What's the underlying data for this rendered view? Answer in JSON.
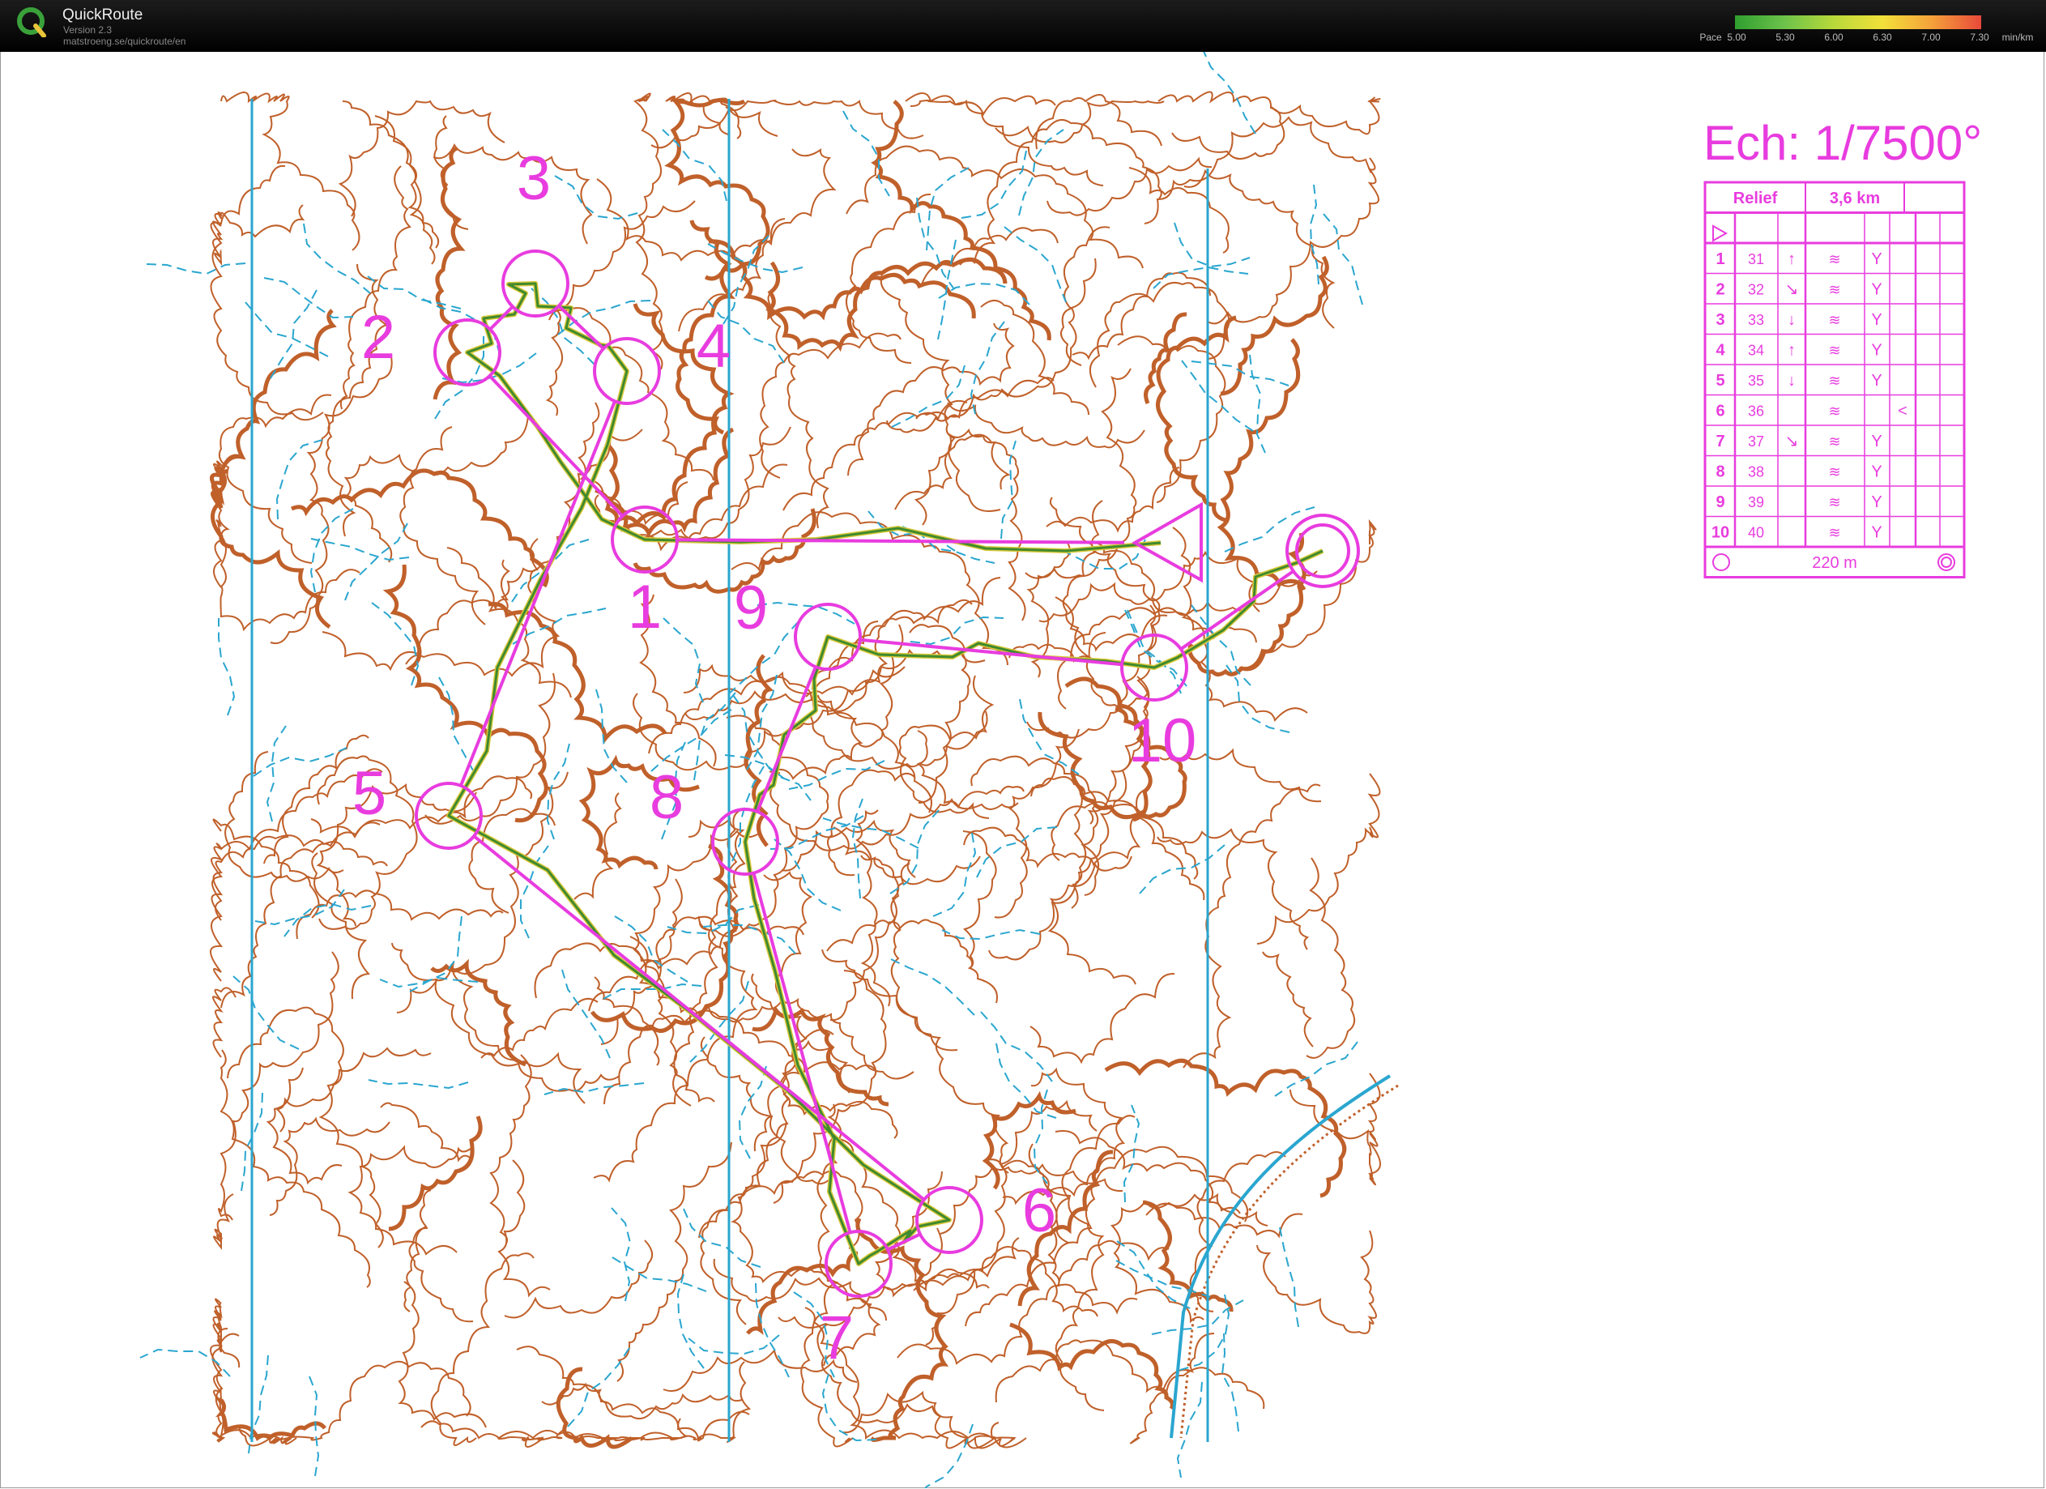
{
  "app": {
    "title": "QuickRoute",
    "version": "Version 2.3",
    "url": "matstroeng.se/quickroute/en"
  },
  "pace_legend": {
    "label": "Pace",
    "ticks": [
      "5.00",
      "5.30",
      "6.00",
      "6.30",
      "7.00",
      "7.30"
    ],
    "unit": "min/km",
    "colors": [
      "#2f9e2f",
      "#6cc24a",
      "#b8d93a",
      "#f2e03a",
      "#f5a13a",
      "#e84a3a"
    ]
  },
  "map": {
    "scale_text": "Ech: 1/7500°",
    "contour_color": "#c0602a",
    "water_color": "#2aa6cf",
    "course_color": "#e83cdf",
    "route_colors": [
      "#3f8a2f",
      "#d9c83a"
    ]
  },
  "course": {
    "controls": [
      {
        "number": "1"
      },
      {
        "number": "2"
      },
      {
        "number": "3"
      },
      {
        "number": "4"
      },
      {
        "number": "5"
      },
      {
        "number": "6"
      },
      {
        "number": "7"
      },
      {
        "number": "8"
      },
      {
        "number": "9"
      },
      {
        "number": "10"
      }
    ]
  },
  "description_sheet": {
    "title": "Relief",
    "length": "3,6 km",
    "rows": [
      {
        "num": "1",
        "code": "31",
        "dir": "↑",
        "feat": "≋",
        "detail": "Y",
        "extra": ""
      },
      {
        "num": "2",
        "code": "32",
        "dir": "↘",
        "feat": "≋",
        "detail": "Y",
        "extra": ""
      },
      {
        "num": "3",
        "code": "33",
        "dir": "↓",
        "feat": "≋",
        "detail": "Y",
        "extra": ""
      },
      {
        "num": "4",
        "code": "34",
        "dir": "↑",
        "feat": "≋",
        "detail": "Y",
        "extra": ""
      },
      {
        "num": "5",
        "code": "35",
        "dir": "↓",
        "feat": "≋",
        "detail": "Y",
        "extra": ""
      },
      {
        "num": "6",
        "code": "36",
        "dir": "",
        "feat": "≋",
        "detail": "",
        "extra": "<"
      },
      {
        "num": "7",
        "code": "37",
        "dir": "↘",
        "feat": "≋",
        "detail": "Y",
        "extra": ""
      },
      {
        "num": "8",
        "code": "38",
        "dir": "",
        "feat": "≋",
        "detail": "Y",
        "extra": ""
      },
      {
        "num": "9",
        "code": "39",
        "dir": "",
        "feat": "≋",
        "detail": "Y",
        "extra": ""
      },
      {
        "num": "10",
        "code": "40",
        "dir": "",
        "feat": "≋",
        "detail": "Y",
        "extra": ""
      }
    ],
    "finish_distance": "220 m"
  }
}
